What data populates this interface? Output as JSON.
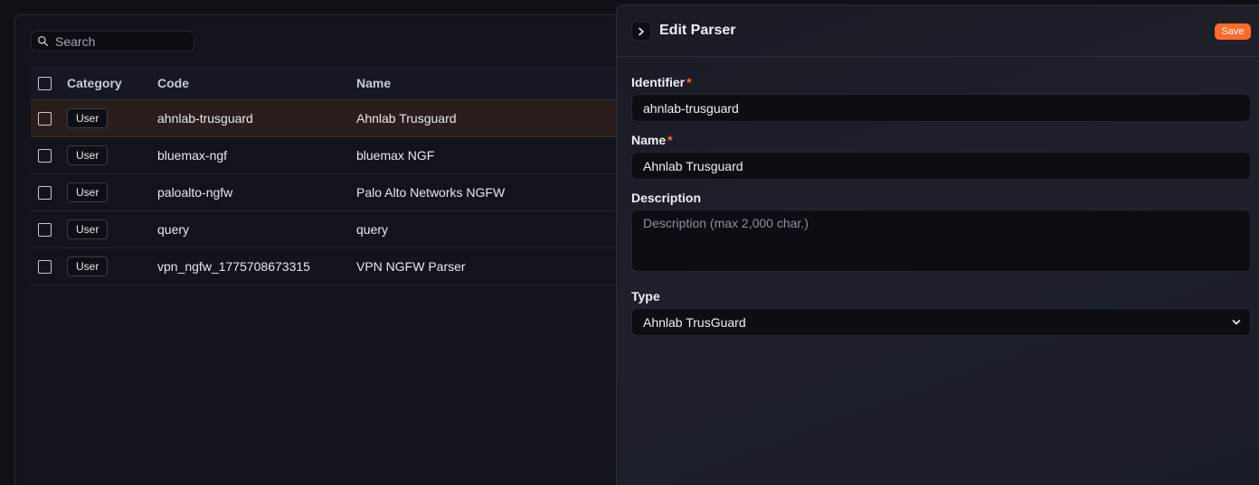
{
  "search": {
    "placeholder": "Search"
  },
  "table": {
    "headers": {
      "category": "Category",
      "code": "Code",
      "name": "Name"
    },
    "rows": [
      {
        "category": "User",
        "code": "ahnlab-trusguard",
        "name": "Ahnlab Trusguard"
      },
      {
        "category": "User",
        "code": "bluemax-ngf",
        "name": "bluemax NGF"
      },
      {
        "category": "User",
        "code": "paloalto-ngfw",
        "name": "Palo Alto Networks NGFW"
      },
      {
        "category": "User",
        "code": "query",
        "name": "query"
      },
      {
        "category": "User",
        "code": "vpn_ngfw_1775708673315",
        "name": "VPN NGFW Parser"
      }
    ]
  },
  "editor": {
    "title": "Edit Parser",
    "save_label": "Save",
    "identifier": {
      "label": "Identifier",
      "required_mark": "*",
      "value": "ahnlab-trusguard"
    },
    "name": {
      "label": "Name",
      "required_mark": "*",
      "value": "Ahnlab Trusguard"
    },
    "description": {
      "label": "Description",
      "placeholder": "Description (max 2,000 char.)"
    },
    "type": {
      "label": "Type",
      "value": "Ahnlab TrusGuard"
    }
  },
  "colors": {
    "accent": "#ff6a2b",
    "selected_row": "#2a1e1c"
  }
}
